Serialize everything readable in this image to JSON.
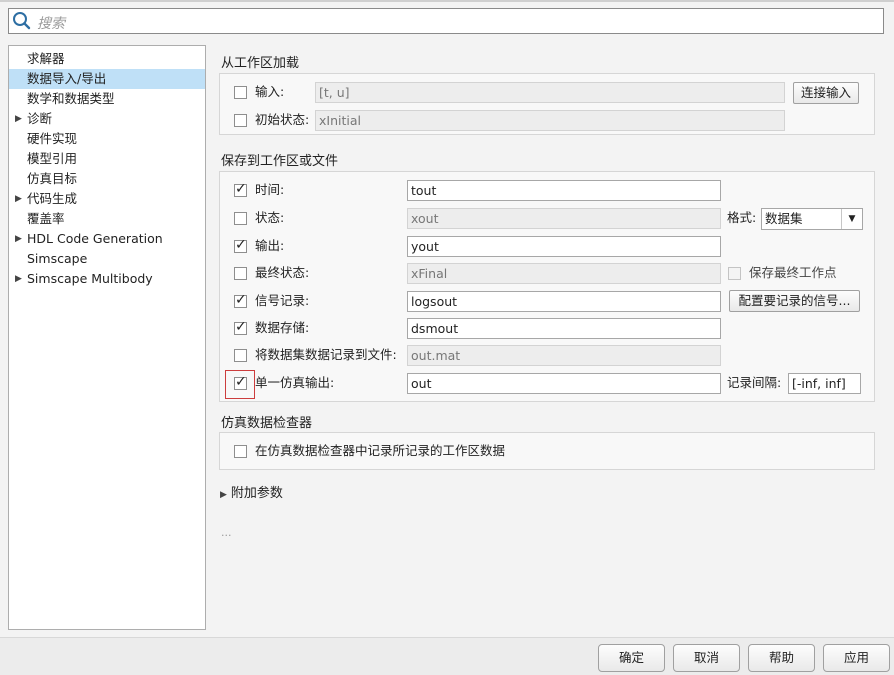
{
  "search": {
    "placeholder": "搜索",
    "icon": "search-icon"
  },
  "tree": {
    "items": [
      {
        "label": "求解器",
        "expandable": false,
        "selected": false
      },
      {
        "label": "数据导入/导出",
        "expandable": false,
        "selected": true
      },
      {
        "label": "数学和数据类型",
        "expandable": false,
        "selected": false
      },
      {
        "label": "诊断",
        "expandable": true,
        "selected": false
      },
      {
        "label": "硬件实现",
        "expandable": false,
        "selected": false
      },
      {
        "label": "模型引用",
        "expandable": false,
        "selected": false
      },
      {
        "label": "仿真目标",
        "expandable": false,
        "selected": false
      },
      {
        "label": "代码生成",
        "expandable": true,
        "selected": false
      },
      {
        "label": "覆盖率",
        "expandable": false,
        "selected": false
      },
      {
        "label": "HDL Code Generation",
        "expandable": true,
        "selected": false
      },
      {
        "label": "Simscape",
        "expandable": false,
        "selected": false
      },
      {
        "label": "Simscape Multibody",
        "expandable": true,
        "selected": false
      }
    ],
    "selected_color": "#bfe0f7"
  },
  "load": {
    "title": "从工作区加载",
    "input_label": "输入:",
    "input_value": "[t, u]",
    "input_checked": false,
    "connect_button": "连接输入",
    "initial_label": "初始状态:",
    "initial_value": "xInitial",
    "initial_checked": false
  },
  "save": {
    "title": "保存到工作区或文件",
    "time_label": "时间:",
    "time_value": "tout",
    "time_checked": true,
    "states_label": "状态:",
    "states_value": "xout",
    "states_checked": false,
    "format_label": "格式:",
    "format_value": "数据集",
    "output_label": "输出:",
    "output_value": "yout",
    "output_checked": true,
    "final_label": "最终状态:",
    "final_value": "xFinal",
    "final_checked": false,
    "save_final_op_label": "保存最终工作点",
    "save_final_op_checked": false,
    "signal_label": "信号记录:",
    "signal_value": "logsout",
    "signal_checked": true,
    "config_signals_button": "配置要记录的信号...",
    "datastore_label": "数据存储:",
    "datastore_value": "dsmout",
    "datastore_checked": true,
    "logfile_label": "将数据集数据记录到文件:",
    "logfile_value": "out.mat",
    "logfile_checked": false,
    "single_output_label": "单一仿真输出:",
    "single_output_value": "out",
    "single_output_checked": true,
    "interval_label": "记录间隔:",
    "interval_value": "[-inf, inf]"
  },
  "inspector": {
    "title": "仿真数据检查器",
    "record_label": "在仿真数据检查器中记录所记录的工作区数据",
    "record_checked": false
  },
  "additional": {
    "label": "附加参数"
  },
  "ellipsis": "...",
  "footer": {
    "ok": "确定",
    "cancel": "取消",
    "help": "帮助",
    "apply": "应用"
  },
  "colors": {
    "highlight": "#cc3d3d",
    "background": "#f3f3f3"
  }
}
